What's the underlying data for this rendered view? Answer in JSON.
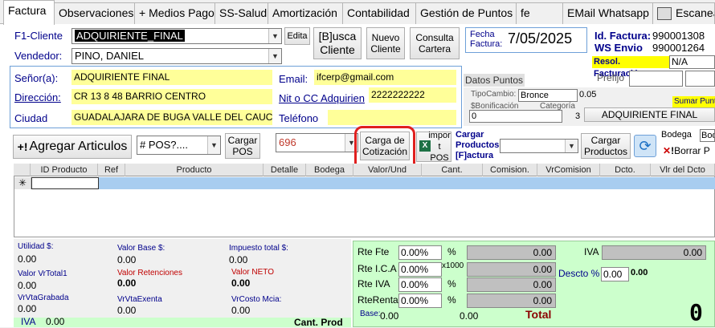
{
  "tabs": [
    "Factura",
    "Observaciones",
    "+ Medios Pago",
    "SS-Salud",
    "Amortización",
    "Contabilidad",
    "Gestión de Puntos",
    "fe",
    "EMail Whatsapp",
    "Escanear"
  ],
  "header": {
    "cliente_label": "F1-Cliente",
    "cliente_value": "ADQUIRIENTE_FINAL",
    "vendedor_label": "Vendedor:",
    "vendedor_value": "PINO, DANIEL",
    "edita_label": "Edita",
    "busca_label": "[B]usca Cliente",
    "nuevo_label": "Nuevo Cliente",
    "consulta_label": "Consulta Cartera",
    "fecha_label": "Fecha Factura:",
    "fecha_value": "7/05/2025",
    "id_factura_label": "Id. Factura:",
    "id_factura_value": "990001308",
    "ws_envio_label": "WS Envio",
    "ws_envio_value": "990001264",
    "resol_label": "Resol. Facturación",
    "resol_value": "N/A",
    "prefijo_label": "Prefijo"
  },
  "client": {
    "senor_label": "Señor(a):",
    "senor_value": "ADQUIRIENTE  FINAL",
    "direccion_label": "Dirección:",
    "direccion_value": "CR 13 8 48 BARRIO CENTRO",
    "ciudad_label": "Ciudad",
    "ciudad_value": "GUADALAJARA DE BUGA  VALLE DEL CAUCA",
    "email_label": "Email:",
    "email_value": "ifcerp@gmail.com",
    "nit_label": "Nit o CC Adquirien",
    "nit_value": "2222222222",
    "telefono_label": "Teléfono",
    "telefono_value": ""
  },
  "puntos": {
    "title": "Datos Puntos",
    "tipo_cambio_label": "TipoCambio:",
    "tipo_cambio_value": "Bronce",
    "tipo_cambio_num": "0.05",
    "bonificacion_label": "$Bonificación",
    "bonificacion_value": "0",
    "categoria_label": "Categoría",
    "categoria_value": "3",
    "sumar_label": "Sumar Puntos",
    "adquiriente_label": "ADQUIRIENTE  FINAL"
  },
  "toolbar": {
    "agregar_label": "Agregar Articulos",
    "pos_value": "# POS?....",
    "cargar_pos_label": "Cargar POS",
    "pos_num_value": "696",
    "carga_cotizacion_label": "Carga de Cotización",
    "import_label": "impor t POS",
    "cargar_productos_title": "Cargar Productos [F]actura",
    "cargar_productos_btn": "Cargar Productos",
    "bodega_label": "Bodega",
    "bodega_value": "Bod",
    "borrar_label": "Borrar P"
  },
  "grid": {
    "columns": [
      "ID Producto",
      "Ref",
      "Producto",
      "Detalle",
      "Bodega",
      "Valor/Und",
      "Cant.",
      "Comision.",
      "VrComision",
      "Dcto.",
      "Vlr del Dcto"
    ]
  },
  "summary": {
    "utilidad_label": "Utilidad $:",
    "utilidad_value": "0.00",
    "valor_base_label": "Valor Base $:",
    "valor_base_value": "0.00",
    "impuesto_label": "Impuesto total $:",
    "impuesto_value": "0.00",
    "vrtotal1_label": "Valor VrTotal1",
    "vrtotal1_value": "0.00",
    "retenciones_label": "Valor Retenciones",
    "retenciones_value": "0.00",
    "neto_label": "Valor NETO",
    "neto_value": "0.00",
    "gravada_label": "VrVtaGrabada",
    "gravada_value": "0.00",
    "exenta_label": "VrVtaExenta",
    "exenta_value": "0.00",
    "costo_label": "VrCosto Mcia:",
    "costo_value": "0.00",
    "iva_label": "IVA",
    "iva_value": "0.00",
    "cant_prod_label": "Cant. Prod"
  },
  "retenciones": {
    "rte_fte_label": "Rte Fte",
    "rte_fte_pct": "0.00%",
    "rte_ica_label": "Rte I.C.A",
    "rte_ica_pct": "0.00%",
    "x1000": "x1000",
    "rte_iva_label": "Rte IVA",
    "rte_iva_pct": "0.00%",
    "rte_renta_label": "RteRenta",
    "rte_renta_pct": "0.00%",
    "pct_sign": "%",
    "value": "0.00",
    "base_label": "Base:",
    "base_value": "0.00",
    "base_value2": "0.00",
    "total_label": "Total",
    "iva_label": "IVA",
    "iva_value": "0.00",
    "descto_label": "Descto %",
    "descto_value": "0.00",
    "descto_value2": "0.00",
    "total_digit": "0"
  }
}
